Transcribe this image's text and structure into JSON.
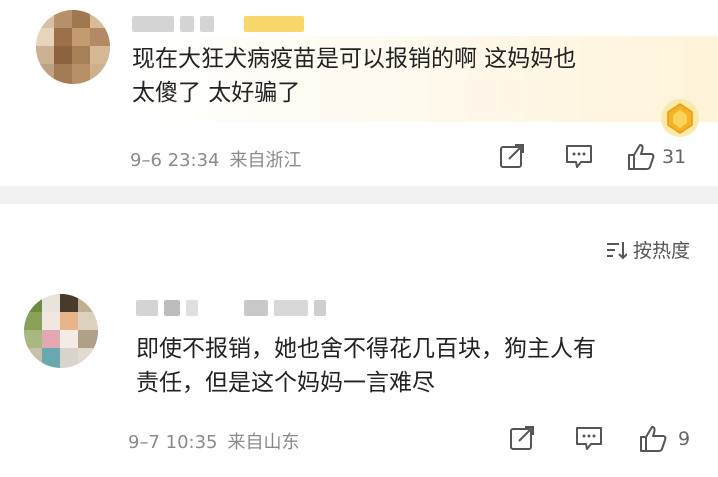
{
  "comments": [
    {
      "lines": [
        "现在大狂犬病疫苗是可以报销的啊 这妈妈也",
        "太傻了 太好骗了"
      ],
      "date": "9–6 23:34",
      "location": "来自浙江",
      "likes": "31"
    },
    {
      "lines": [
        "即使不报销，她也舍不得花几百块，狗主人有",
        "责任，但是这个妈妈一言难尽"
      ],
      "date": "9–7 10:35",
      "location": "来自山东",
      "likes": "9"
    }
  ],
  "sort": {
    "label": "按热度"
  },
  "icons": {
    "share": "share-icon",
    "comment": "comment-icon",
    "like": "thumbs-up-icon",
    "sort": "sort-icon",
    "badge": "gold-badge-icon"
  },
  "colors": {
    "accent": "#f5b428",
    "icon": "#555555",
    "meta": "#8a8a8a"
  }
}
